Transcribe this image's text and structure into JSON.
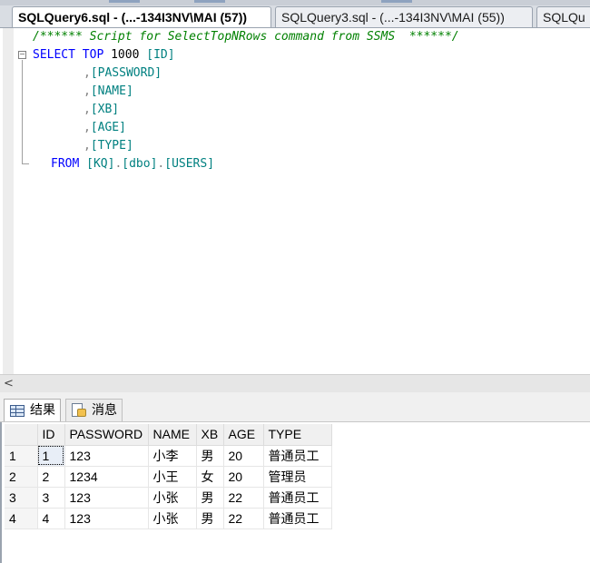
{
  "tabs": [
    {
      "label": "SQLQuery6.sql - (...-134I3NV\\MAI (57))",
      "active": true
    },
    {
      "label": "SQLQuery3.sql - (...-134I3NV\\MAI (55))",
      "active": false
    },
    {
      "label": "SQLQu",
      "active": false
    }
  ],
  "editor": {
    "comment": "/****** Script for SelectTopNRows command from SSMS  ******/",
    "select_kw": "SELECT",
    "top_kw": "TOP",
    "top_n": "1000",
    "columns": [
      "[ID]",
      "[PASSWORD]",
      "[NAME]",
      "[XB]",
      "[AGE]",
      "[TYPE]"
    ],
    "from_kw": "FROM",
    "from_parts": [
      "[KQ]",
      "[dbo]",
      "[USERS]"
    ],
    "fold_symbol": "−"
  },
  "scrollbar": {
    "left_arrow": "<"
  },
  "result_tabs": [
    {
      "label": "结果",
      "icon": "grid-icon",
      "active": true
    },
    {
      "label": "消息",
      "icon": "message-icon",
      "active": false
    }
  ],
  "grid": {
    "columns": [
      "ID",
      "PASSWORD",
      "NAME",
      "XB",
      "AGE",
      "TYPE"
    ],
    "rows": [
      {
        "num": "1",
        "cells": [
          "1",
          "123",
          "小李",
          "男",
          "20",
          "普通员工"
        ]
      },
      {
        "num": "2",
        "cells": [
          "2",
          "1234",
          "小王",
          "女",
          "20",
          "管理员"
        ]
      },
      {
        "num": "3",
        "cells": [
          "3",
          "123",
          "小张",
          "男",
          "22",
          "普通员工"
        ]
      },
      {
        "num": "4",
        "cells": [
          "4",
          "123",
          "小张",
          "男",
          "22",
          "普通员工"
        ]
      }
    ]
  }
}
